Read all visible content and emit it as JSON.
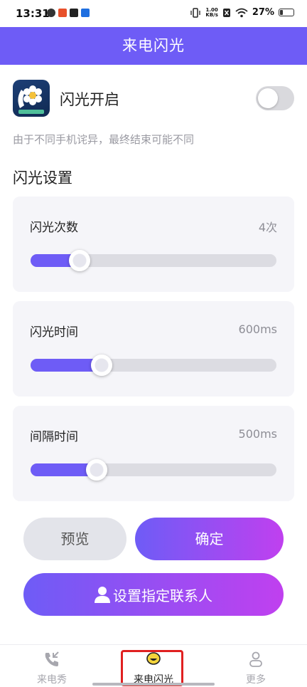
{
  "status_bar": {
    "time": "13:31",
    "speed_value": "1.00",
    "speed_unit": "KB/s",
    "battery": "27%",
    "battery_level": 0.27
  },
  "header": {
    "title": "来电闪光"
  },
  "flash_toggle": {
    "label": "闪光开启",
    "enabled": false
  },
  "note": "由于不同手机诧异，最终结束可能不同",
  "settings": {
    "title": "闪光设置",
    "items": [
      {
        "label": "闪光次数",
        "value": "4次",
        "level": 0.2
      },
      {
        "label": "闪光时间",
        "value": "600ms",
        "level": 0.29
      },
      {
        "label": "间隔时间",
        "value": "500ms",
        "level": 0.27
      }
    ]
  },
  "buttons": {
    "preview": "预览",
    "confirm": "确定",
    "set_contact": "设置指定联系人"
  },
  "tabs": [
    {
      "label": "来电秀",
      "icon": "phone-incoming-icon"
    },
    {
      "label": "来电闪光",
      "icon": "smile-bubble-icon",
      "active": true
    },
    {
      "label": "更多",
      "icon": "person-icon"
    }
  ],
  "colors": {
    "accent": "#6e5cf6",
    "gradient_end": "#c040ef"
  }
}
